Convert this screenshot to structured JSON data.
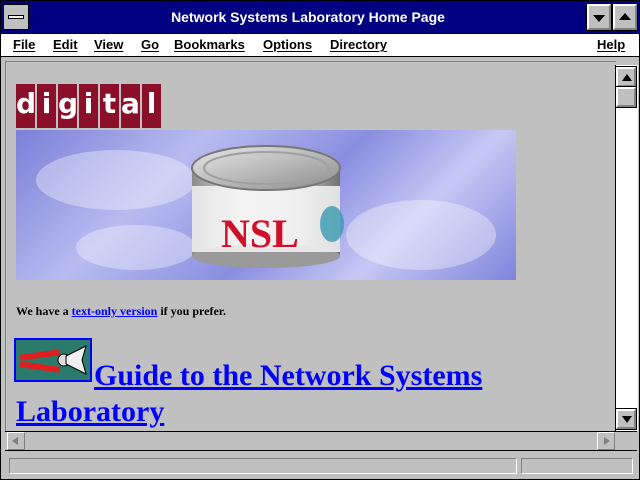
{
  "window": {
    "title": "Network Systems Laboratory Home Page"
  },
  "menu": {
    "file": "File",
    "edit": "Edit",
    "view": "View",
    "go": "Go",
    "bookmarks": "Bookmarks",
    "options": "Options",
    "directory": "Directory",
    "help": "Help"
  },
  "page": {
    "logo_letters": [
      "d",
      "i",
      "g",
      "i",
      "t",
      "a",
      "l"
    ],
    "banner_text": "NSL",
    "notice_prefix": "We have a ",
    "notice_link": "text-only version",
    "notice_suffix": " if you prefer.",
    "guide_line1": "Guide to the Network Systems",
    "guide_line2": "Laboratory"
  },
  "colors": {
    "titlebar": "#000080",
    "link": "#0000ff",
    "logo": "#8b0f2b"
  }
}
